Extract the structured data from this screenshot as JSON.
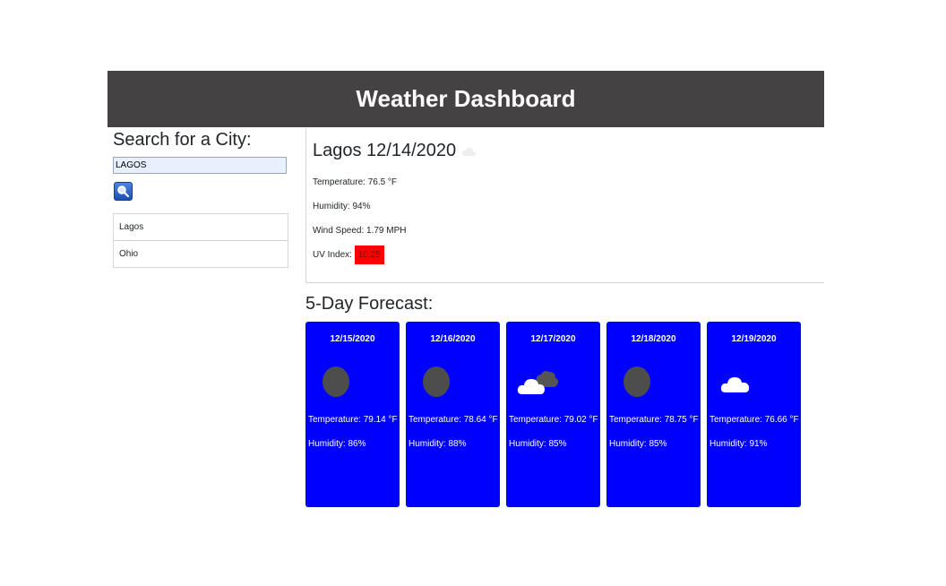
{
  "header": {
    "title": "Weather Dashboard"
  },
  "search": {
    "heading": "Search for a City:",
    "input_value": "LAGOS",
    "button_icon": "search-icon"
  },
  "history": [
    "Lagos",
    "Ohio"
  ],
  "current": {
    "title": "Lagos 12/14/2020",
    "icon": "cloud-icon",
    "temperature": "Temperature: 76.5 °F",
    "humidity": "Humidity: 94%",
    "wind": "Wind Speed: 1.79 MPH",
    "uv_label": "UV Index:",
    "uv_value": "10.25",
    "uv_color": "#ff0000"
  },
  "forecast": {
    "heading": "5-Day Forecast:",
    "card_color": "#0000ff",
    "days": [
      {
        "date": "12/15/2020",
        "icon": "moon-icon",
        "temp": "Temperature: 79.14 °F",
        "humidity": "Humidity: 86%"
      },
      {
        "date": "12/16/2020",
        "icon": "moon-icon",
        "temp": "Temperature: 78.64 °F",
        "humidity": "Humidity: 88%"
      },
      {
        "date": "12/17/2020",
        "icon": "broken-clouds-icon",
        "temp": "Temperature: 79.02 °F",
        "humidity": "Humidity: 85%"
      },
      {
        "date": "12/18/2020",
        "icon": "moon-icon",
        "temp": "Temperature: 78.75 °F",
        "humidity": "Humidity: 85%"
      },
      {
        "date": "12/19/2020",
        "icon": "cloud-icon",
        "temp": "Temperature: 76.66 °F",
        "humidity": "Humidity: 91%"
      }
    ]
  }
}
